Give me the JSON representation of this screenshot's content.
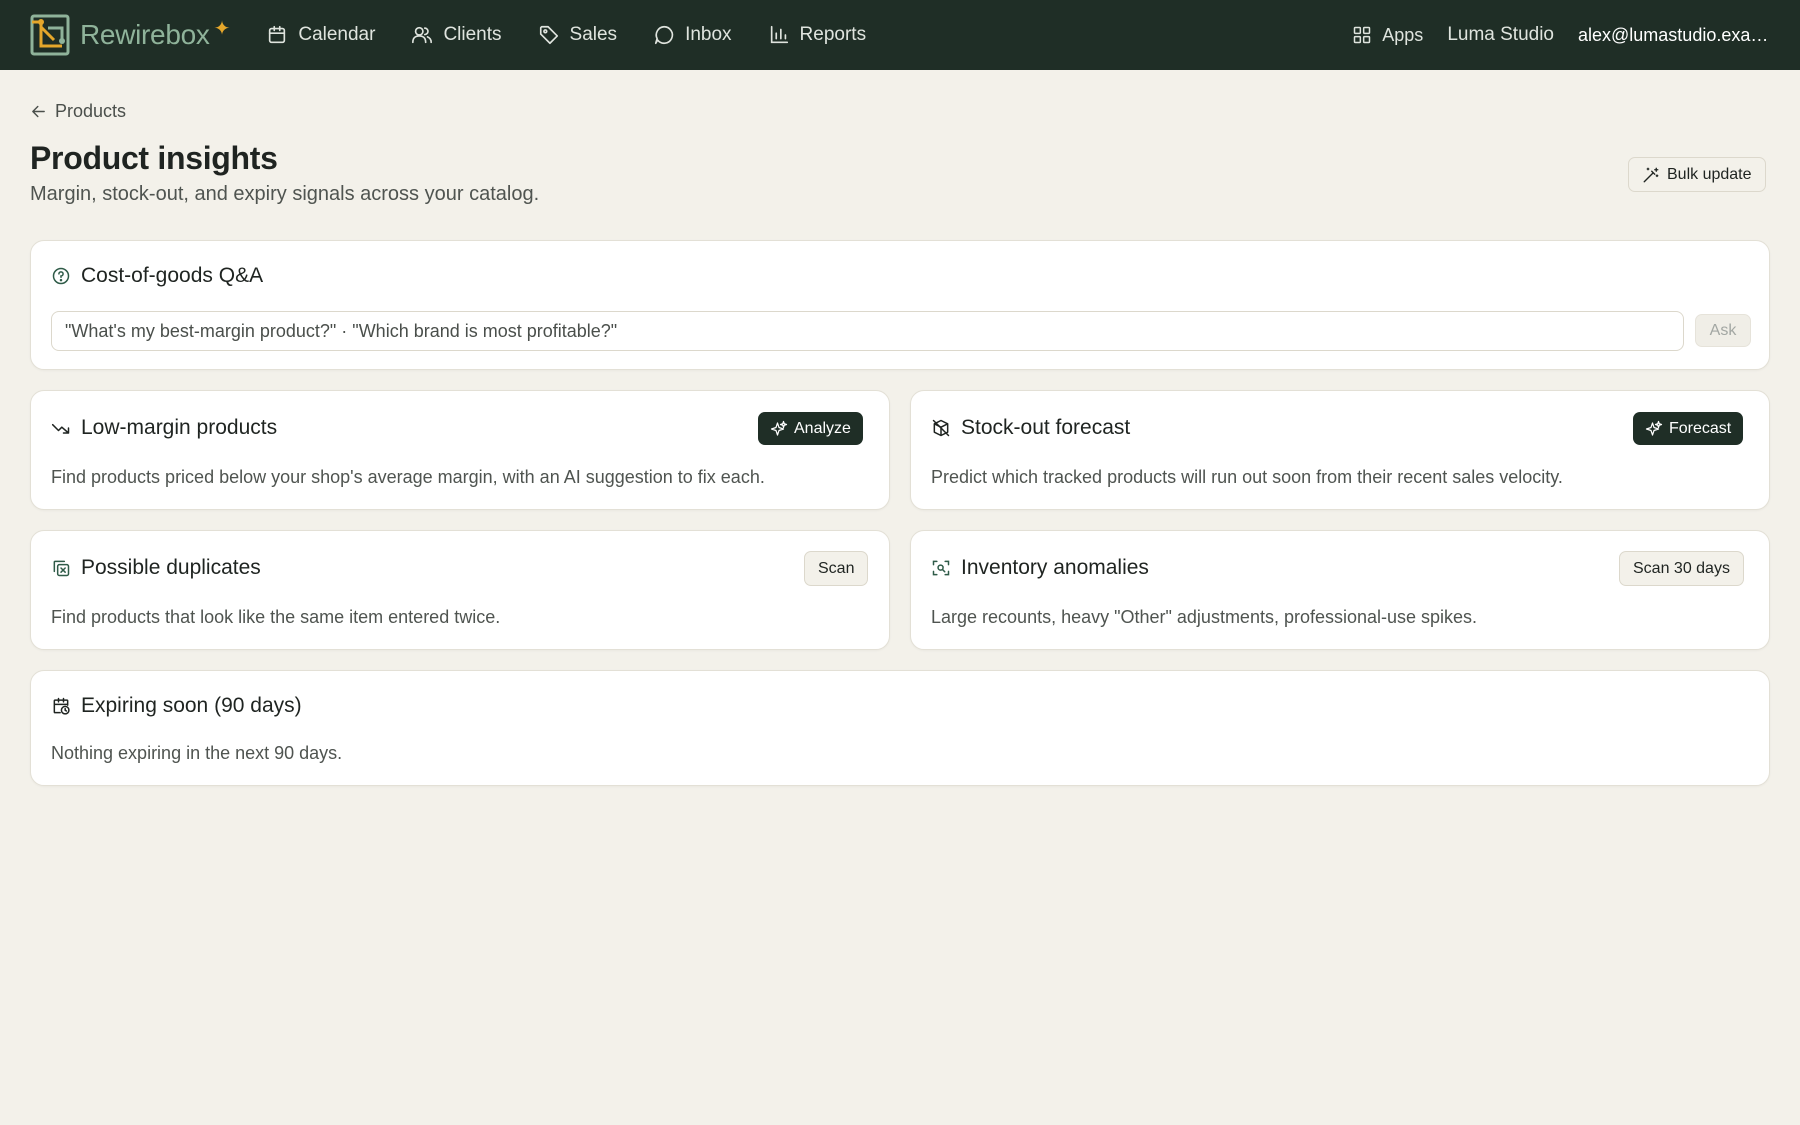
{
  "brand": {
    "name": "Rewirebox",
    "spark": "✦"
  },
  "nav": {
    "items": [
      {
        "label": "Calendar",
        "icon": "calendar-icon"
      },
      {
        "label": "Clients",
        "icon": "users-icon"
      },
      {
        "label": "Sales",
        "icon": "tag-icon"
      },
      {
        "label": "Inbox",
        "icon": "chat-bubble-icon"
      },
      {
        "label": "Reports",
        "icon": "bar-chart-icon"
      }
    ],
    "apps_label": "Apps",
    "studio": "Luma Studio",
    "email": "alex@lumastudio.example.com"
  },
  "header": {
    "back_label": "Products",
    "title": "Product insights",
    "subtitle": "Margin, stock-out, and expiry signals across your catalog.",
    "bulk_label": "Bulk update"
  },
  "qa": {
    "title": "Cost-of-goods Q&A",
    "placeholder": "\"What's my best-margin product?\" · \"Which brand is most profitable?\"",
    "ask_label": "Ask"
  },
  "cards": {
    "low_margin": {
      "title": "Low-margin products",
      "button": "Analyze",
      "desc": "Find products priced below your shop's average margin, with an AI suggestion to fix each."
    },
    "stockout": {
      "title": "Stock-out forecast",
      "button": "Forecast",
      "desc": "Predict which tracked products will run out soon from their recent sales velocity."
    },
    "duplicates": {
      "title": "Possible duplicates",
      "button": "Scan",
      "desc": "Find products that look like the same item entered twice."
    },
    "anomalies": {
      "title": "Inventory anomalies",
      "button": "Scan 30 days",
      "desc": "Large recounts, heavy \"Other\" adjustments, professional-use spikes."
    },
    "expiring": {
      "title": "Expiring soon (90 days)",
      "desc": "Nothing expiring in the next 90 days."
    }
  },
  "colors": {
    "topbar": "#1f2e26",
    "background": "#f3f1ea",
    "brand_text": "#8fb39a",
    "brand_accent": "#e5a72b"
  }
}
